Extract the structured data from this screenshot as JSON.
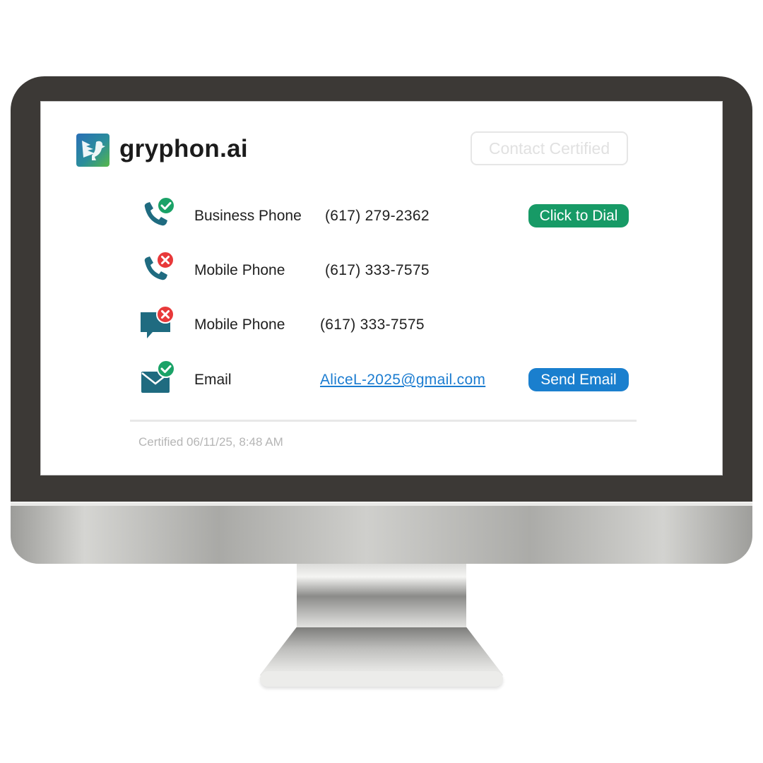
{
  "brand": {
    "name": "gryphon.ai",
    "logo_icon": "gryphon-logo-icon"
  },
  "header": {
    "badge_label": "Contact Certified"
  },
  "contacts": [
    {
      "channel_icon": "phone-icon",
      "status_icon": "check-circle-icon",
      "status": "verified",
      "label": "Business Phone",
      "value": "(617) 279-2362",
      "action_label": "Click to Dial"
    },
    {
      "channel_icon": "phone-icon",
      "status_icon": "x-circle-icon",
      "status": "blocked",
      "label": "Mobile Phone",
      "value": "(617) 333-7575"
    },
    {
      "channel_icon": "chat-bubble-icon",
      "status_icon": "x-circle-icon",
      "status": "blocked",
      "label": "Mobile Phone",
      "value": "(617) 333-7575"
    },
    {
      "channel_icon": "envelope-icon",
      "status_icon": "check-circle-icon",
      "status": "verified",
      "label": "Email",
      "value": "AliceL-2025@gmail.com",
      "action_label": "Send Email"
    }
  ],
  "footer": {
    "certified_text": "Certified 06/11/25, 8:48 AM"
  },
  "colors": {
    "icon_teal": "#1f6b80",
    "verified_green": "#1aa267",
    "blocked_red": "#e8393a",
    "dial_button": "#179a66",
    "email_button": "#1a7fce",
    "link": "#1b7cd0",
    "bezel": "#3c3936"
  }
}
